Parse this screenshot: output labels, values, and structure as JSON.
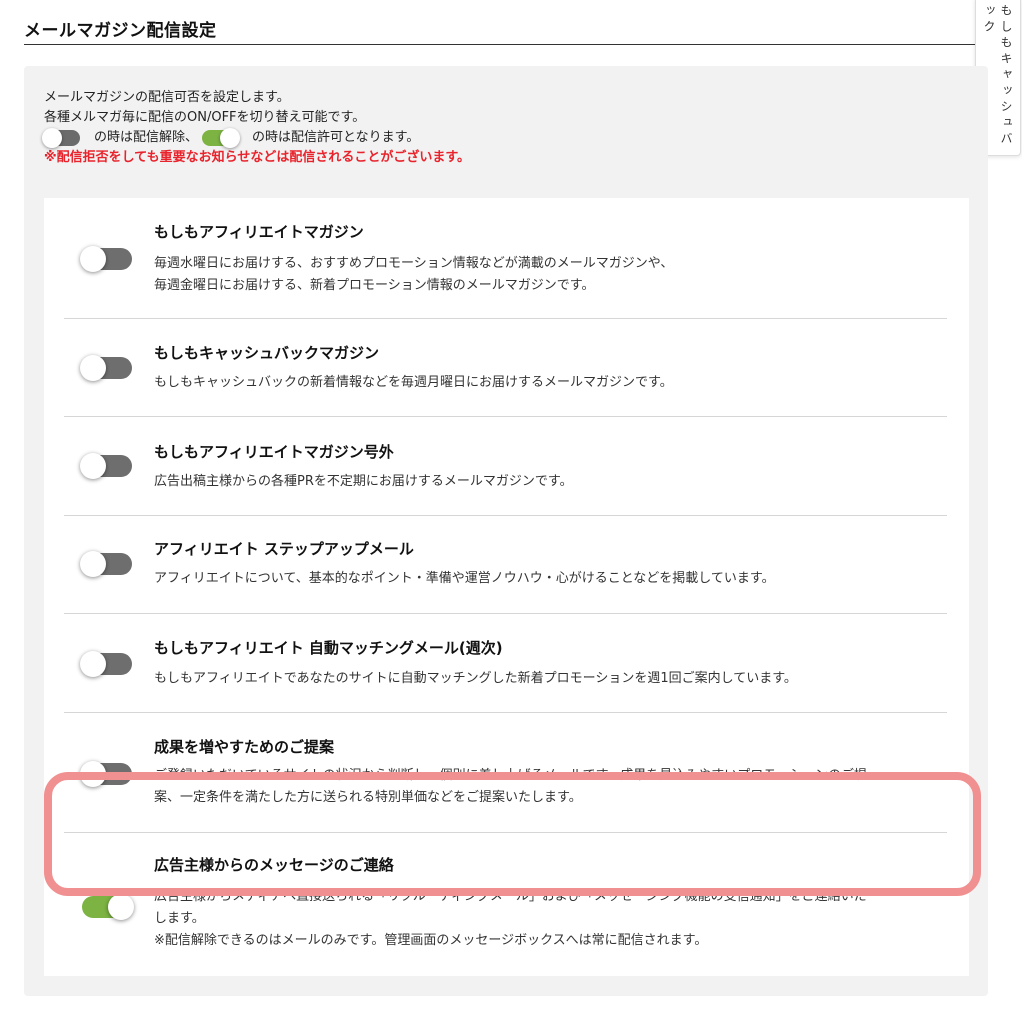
{
  "page": {
    "title": "メールマガジン配信設定",
    "side_tab_label": "もしもキャッシュバック"
  },
  "intro": {
    "line1": "メールマガジンの配信可否を設定します。",
    "line2": "各種メルマガ毎に配信のON/OFFを切り替え可能です。",
    "off_text": "の時は配信解除、",
    "on_text": "の時は配信許可となります。",
    "warning": "※配信拒否をしても重要なお知らせなどは配信されることがございます。"
  },
  "colors": {
    "toggle_on": "#7cb342",
    "toggle_off": "#6e6e6e",
    "warning": "#e8232c",
    "highlight": "#f09090"
  },
  "subscriptions": [
    {
      "title": "もしもアフィリエイトマガジン",
      "desc1": "毎週水曜日にお届けする、おすすめプロモーション情報などが満載のメールマガジンや、",
      "desc2": "毎週金曜日にお届けする、新着プロモーション情報のメールマガジンです。",
      "enabled": false
    },
    {
      "title": "もしもキャッシュバックマガジン",
      "desc1": "もしもキャッシュバックの新着情報などを毎週月曜日にお届けするメールマガジンです。",
      "enabled": false
    },
    {
      "title": "もしもアフィリエイトマガジン号外",
      "desc1": "広告出稿主様からの各種PRを不定期にお届けするメールマガジンです。",
      "enabled": false
    },
    {
      "title": "アフィリエイト ステップアップメール",
      "desc1": "アフィリエイトについて、基本的なポイント・準備や運営ノウハウ・心がけることなどを掲載しています。",
      "enabled": false
    },
    {
      "title": "もしもアフィリエイト 自動マッチングメール(週次)",
      "desc1": "もしもアフィリエイトであなたのサイトに自動マッチングした新着プロモーションを週1回ご案内しています。",
      "enabled": false
    },
    {
      "title": "成果を増やすためのご提案",
      "desc1": "ご登録いただいているサイトの状況から判断し、個別に差し上げるメールです。成果を見込みやすいプロモーションのご提",
      "desc2": "案、一定条件を満たした方に送られる特別単価などをご提案いたします。",
      "enabled": false
    },
    {
      "title": "広告主様からのメッセージのご連絡",
      "desc1": "広告主様からメディアへ直接送られる「リクルーティングメール」および「メッセージング機能の受信通知」をご連絡いた",
      "desc2": "します。",
      "desc3": "※配信解除できるのはメールのみです。管理画面のメッセージボックスへは常に配信されます。",
      "enabled": true
    }
  ]
}
